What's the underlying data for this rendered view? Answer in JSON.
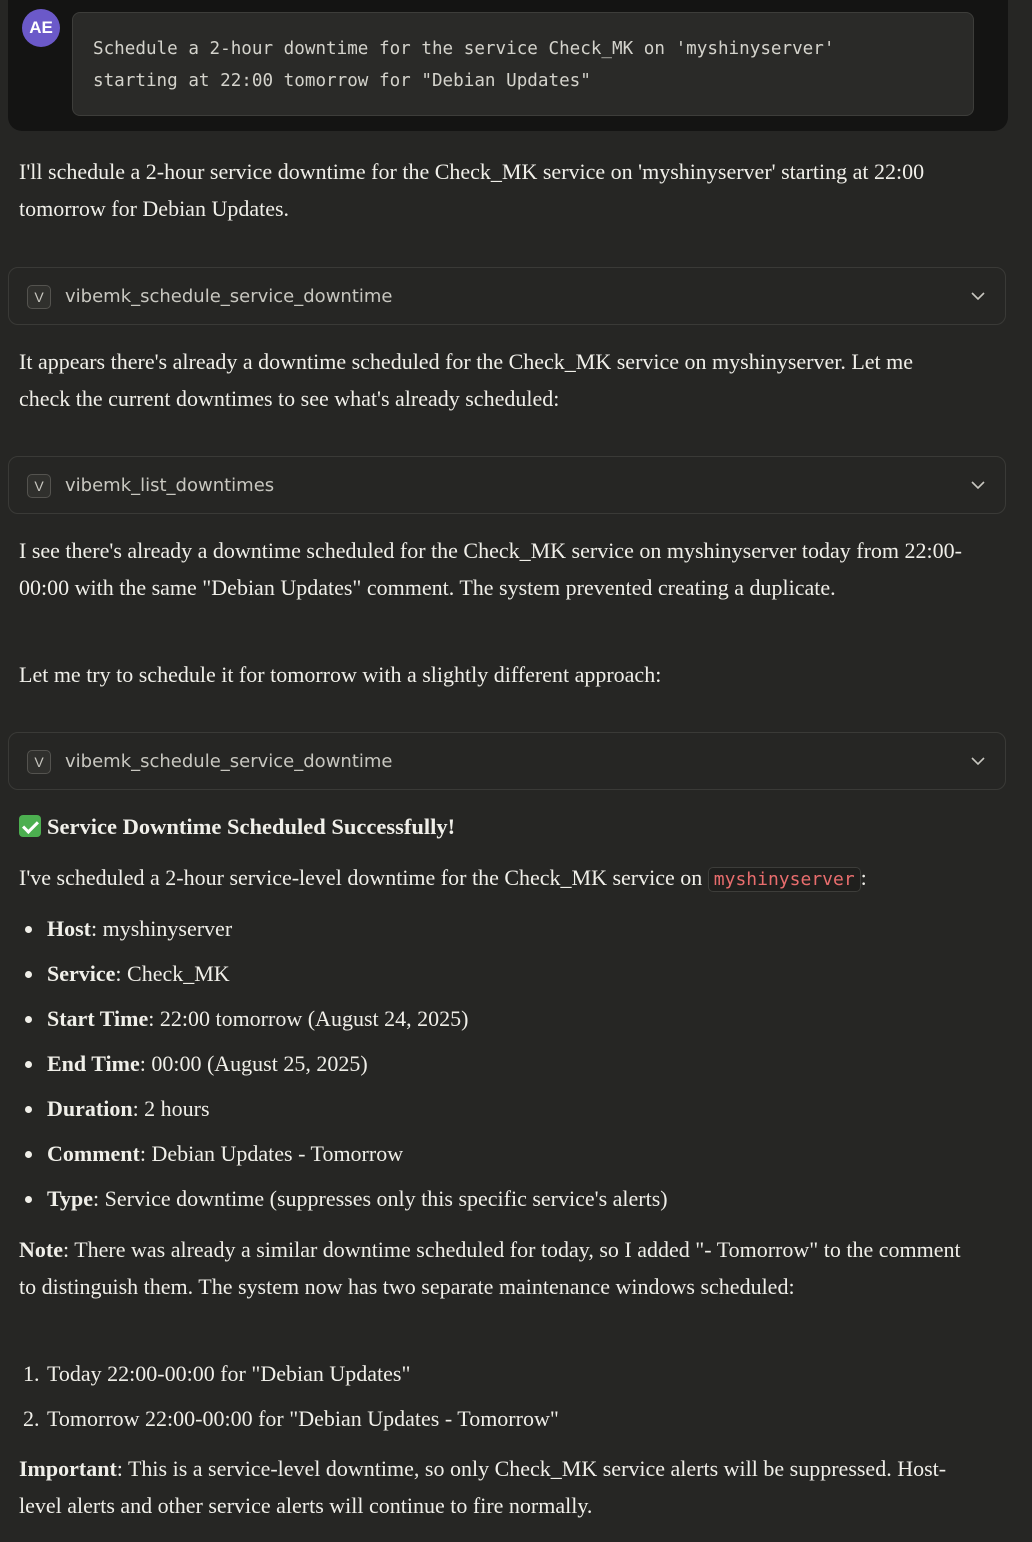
{
  "user": {
    "avatar_initials": "AE",
    "message": "Schedule a 2-hour downtime for the service Check_MK on 'myshinyserver'\nstarting at 22:00 tomorrow for \"Debian Updates\""
  },
  "assistant": {
    "intro": "I'll schedule a 2-hour service downtime for the Check_MK service on 'myshinyserver' starting at 22:00 tomorrow for Debian Updates.",
    "tool1": {
      "badge": "V",
      "name": "vibemk_schedule_service_downtime"
    },
    "p2": "It appears there's already a downtime scheduled for the Check_MK service on myshinyserver. Let me check the current downtimes to see what's already scheduled:",
    "tool2": {
      "badge": "V",
      "name": "vibemk_list_downtimes"
    },
    "p3": "I see there's already a downtime scheduled for the Check_MK service on myshinyserver today from 22:00-00:00 with the same \"Debian Updates\" comment. The system prevented creating a duplicate.",
    "p4": "Let me try to schedule it for tomorrow with a slightly different approach:",
    "tool3": {
      "badge": "V",
      "name": "vibemk_schedule_service_downtime"
    },
    "success_heading": "Service Downtime Scheduled Successfully!",
    "summary_prefix": "I've scheduled a 2-hour service-level downtime for the Check_MK service on ",
    "summary_code": "myshinyserver",
    "summary_suffix": ":",
    "details": [
      {
        "label": "Host",
        "value": ": myshinyserver"
      },
      {
        "label": "Service",
        "value": ": Check_MK"
      },
      {
        "label": "Start Time",
        "value": ": 22:00 tomorrow (August 24, 2025)"
      },
      {
        "label": "End Time",
        "value": ": 00:00 (August 25, 2025)"
      },
      {
        "label": "Duration",
        "value": ": 2 hours"
      },
      {
        "label": "Comment",
        "value": ": Debian Updates - Tomorrow"
      },
      {
        "label": "Type",
        "value": ": Service downtime (suppresses only this specific service's alerts)"
      }
    ],
    "note_label": "Note",
    "note_text": ": There was already a similar downtime scheduled for today, so I added \"- Tomorrow\" to the comment to distinguish them. The system now has two separate maintenance windows scheduled:",
    "windows": [
      {
        "num": "1.",
        "text": "Today 22:00-00:00 for \"Debian Updates\""
      },
      {
        "num": "2.",
        "text": "Tomorrow 22:00-00:00 for \"Debian Updates - Tomorrow\""
      }
    ],
    "important_label": "Important",
    "important_text": ": This is a service-level downtime, so only Check_MK service alerts will be suppressed. Host-level alerts and other service alerts will continue to fire normally."
  }
}
